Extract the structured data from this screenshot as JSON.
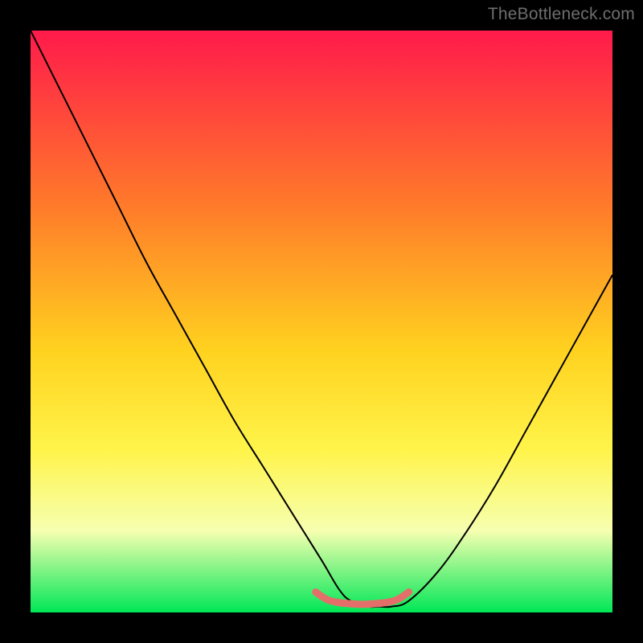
{
  "watermark": "TheBottleneck.com",
  "colors": {
    "frame": "#000000",
    "gradient_top": "#ff1a4b",
    "gradient_mid1": "#ff7a2a",
    "gradient_mid2": "#ffd21f",
    "gradient_mid3": "#fff44a",
    "gradient_mid4": "#f6ffb0",
    "gradient_bottom": "#00e756",
    "curve": "#000000",
    "highlight": "#e46f6a"
  },
  "chart_data": {
    "type": "line",
    "title": "",
    "xlabel": "",
    "ylabel": "",
    "xlim": [
      0,
      100
    ],
    "ylim": [
      0,
      100
    ],
    "series": [
      {
        "name": "bottleneck-curve",
        "x": [
          0,
          5,
          10,
          15,
          20,
          25,
          30,
          35,
          40,
          45,
          50,
          53,
          55,
          58,
          60,
          62,
          65,
          70,
          75,
          80,
          85,
          90,
          95,
          100
        ],
        "y": [
          100,
          90,
          80,
          70,
          60,
          51,
          42,
          33,
          25,
          17,
          9,
          4,
          2,
          1,
          1,
          1,
          2,
          7,
          14,
          22,
          31,
          40,
          49,
          58
        ]
      },
      {
        "name": "highlight-band",
        "x": [
          49,
          51,
          53,
          55,
          57,
          59,
          61,
          63,
          65
        ],
        "y": [
          3.5,
          2.2,
          1.7,
          1.5,
          1.4,
          1.5,
          1.7,
          2.2,
          3.5
        ]
      }
    ],
    "gradient_stops": [
      {
        "offset": 0.0,
        "color": "#ff1a4b"
      },
      {
        "offset": 0.3,
        "color": "#ff7a2a"
      },
      {
        "offset": 0.55,
        "color": "#ffd21f"
      },
      {
        "offset": 0.72,
        "color": "#fff44a"
      },
      {
        "offset": 0.86,
        "color": "#f6ffb0"
      },
      {
        "offset": 1.0,
        "color": "#00e756"
      }
    ]
  }
}
